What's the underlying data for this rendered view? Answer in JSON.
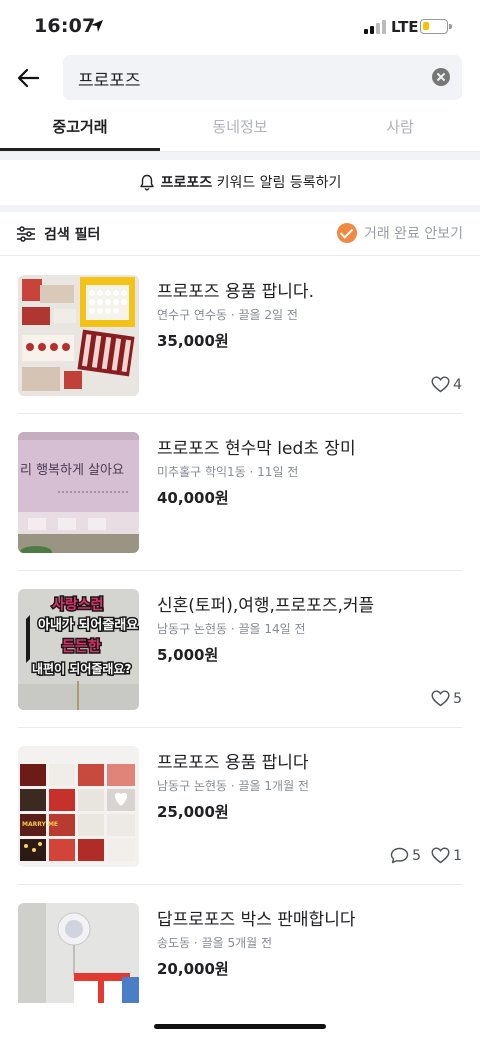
{
  "status": {
    "time": "16:07",
    "network": "LTE",
    "battery_level": 0.25
  },
  "search": {
    "query": "프로포즈"
  },
  "tabs": [
    {
      "label": "중고거래",
      "active": true
    },
    {
      "label": "동네정보",
      "active": false
    },
    {
      "label": "사람",
      "active": false
    }
  ],
  "alert": {
    "keyword": "프로포즈",
    "text": " 키워드 알림 등록하기"
  },
  "filter": {
    "label": "검색 필터",
    "hide_completed": "거래 완료 안보기",
    "accent": "#f08a43"
  },
  "items": [
    {
      "title": "프로포즈 용품 팝니다.",
      "meta": "연수구 연수동 · 끌올 2일 전",
      "price": "35,000원",
      "likes": "4",
      "chats": ""
    },
    {
      "title": "프로포즈 현수막 led초 장미",
      "meta": "미추홀구 학익1동 · 11일 전",
      "price": "40,000원",
      "likes": "",
      "chats": ""
    },
    {
      "title": "신혼(토퍼),여행,프로포즈,커플",
      "meta": "남동구 논현동 · 끌올 14일 전",
      "price": "5,000원",
      "likes": "5",
      "chats": ""
    },
    {
      "title": "프로포즈 용품 팝니다",
      "meta": "남동구 논현동 · 끌올 1개월 전",
      "price": "25,000원",
      "likes": "1",
      "chats": "5"
    },
    {
      "title": "답프로포즈 박스 판매합니다",
      "meta": "송도동 · 끌올 5개월 전",
      "price": "20,000원",
      "likes": "",
      "chats": ""
    }
  ],
  "thumb_texts": {
    "banner": "리 행복하게 살아요",
    "topper": [
      "사랑스런",
      "아내가 되어줄래요",
      "든든한",
      "내편이 되어줄래요?"
    ],
    "collage": "MARRY ME"
  }
}
